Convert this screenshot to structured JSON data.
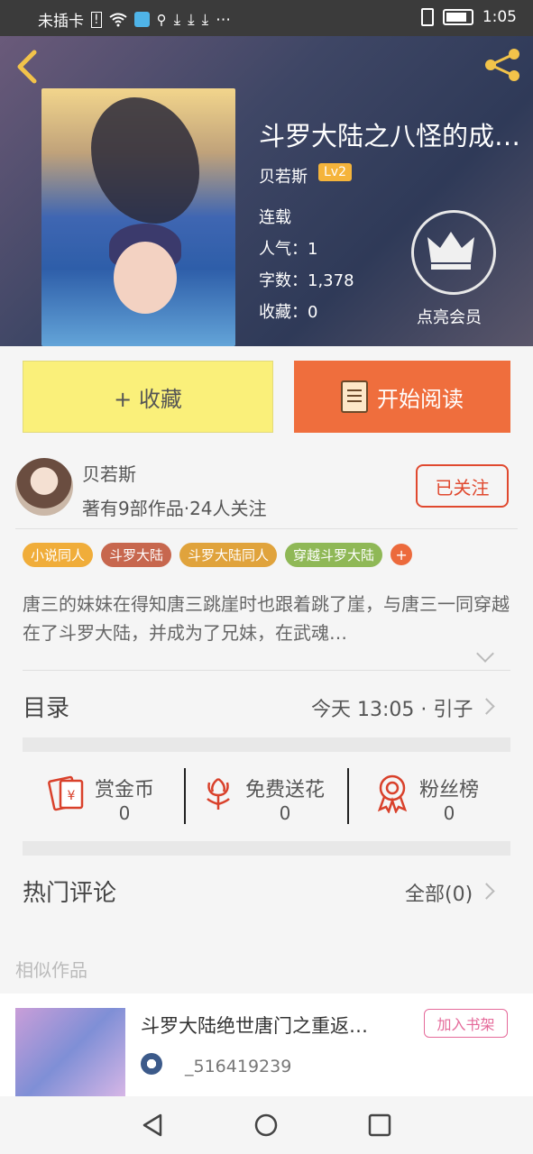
{
  "status_bar": {
    "carrier": "未插卡",
    "time": "1:05",
    "icons": [
      "sim-alert-icon",
      "wifi-icon",
      "app-icon",
      "search-icon",
      "download-icon",
      "download-icon",
      "download-icon",
      "more-icon",
      "vibrate-icon",
      "battery-icon"
    ]
  },
  "header": {
    "back_icon": "chevron-left-icon",
    "share_icon": "share-icon"
  },
  "book": {
    "title": "斗罗大陆之八怪的成…",
    "author": "贝若斯",
    "level": "Lv2",
    "status": "连载",
    "popularity": "人气：1",
    "word_count": "字数：1,378",
    "favorites": "收藏：0",
    "vip_label": "点亮会员"
  },
  "actions": {
    "collect_label": "+ 收藏",
    "read_label": "开始阅读"
  },
  "author_card": {
    "name": "贝若斯",
    "info": "著有9部作品·24人关注",
    "follow_label": "已关注"
  },
  "tags": [
    {
      "label": "小说同人",
      "color": "#f0ad3a"
    },
    {
      "label": "斗罗大陆",
      "color": "#c7674e"
    },
    {
      "label": "斗罗大陆同人",
      "color": "#e0a33c"
    },
    {
      "label": "穿越斗罗大陆",
      "color": "#8fb856"
    }
  ],
  "description": "唐三的妹妹在得知唐三跳崖时也跟着跳了崖，与唐三一同穿越在了斗罗大陆，并成为了兄妹，在武魂…",
  "toc": {
    "title": "目录",
    "latest": "今天 13:05 · 引子"
  },
  "stats": [
    {
      "label": "赏金币",
      "value": "0",
      "icon": "red-envelope-icon"
    },
    {
      "label": "免费送花",
      "value": "0",
      "icon": "flower-icon"
    },
    {
      "label": "粉丝榜",
      "value": "0",
      "icon": "medal-icon"
    }
  ],
  "comments": {
    "title": "热门评论",
    "all_label": "全部(0)"
  },
  "similar": {
    "header": "相似作品",
    "items": [
      {
        "title": "斗罗大陆绝世唐门之重返…",
        "user": "_516419239",
        "shelf_label": "加入书架"
      }
    ]
  },
  "nav": {
    "back": "nav-back-icon",
    "home": "nav-home-icon",
    "recents": "nav-recents-icon"
  }
}
